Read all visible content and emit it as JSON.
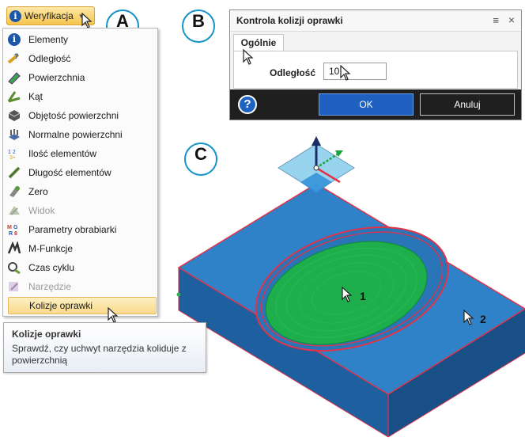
{
  "ribbon": {
    "label": "Weryfikacja",
    "icon": "info-icon"
  },
  "menu": {
    "items": [
      {
        "label": "Elementy",
        "icon": "info-icon",
        "enabled": true
      },
      {
        "label": "Odległość",
        "icon": "ruler-distance-icon",
        "enabled": true
      },
      {
        "label": "Powierzchnia",
        "icon": "surface-icon",
        "enabled": true
      },
      {
        "label": "Kąt",
        "icon": "angle-icon",
        "enabled": true
      },
      {
        "label": "Objętość powierzchni",
        "icon": "volume-icon",
        "enabled": true
      },
      {
        "label": "Normalne powierzchni",
        "icon": "normals-icon",
        "enabled": true
      },
      {
        "label": "Ilość elementów",
        "icon": "count-icon",
        "enabled": true
      },
      {
        "label": "Długość elementów",
        "icon": "length-icon",
        "enabled": true
      },
      {
        "label": "Zero",
        "icon": "zero-icon",
        "enabled": true
      },
      {
        "label": "Widok",
        "icon": "view-icon",
        "enabled": false
      },
      {
        "label": "Parametry obrabiarki",
        "icon": "machine-params-icon",
        "enabled": true
      },
      {
        "label": "M-Funkcje",
        "icon": "m-functions-icon",
        "enabled": true
      },
      {
        "label": "Czas cyklu",
        "icon": "cycle-time-icon",
        "enabled": true
      },
      {
        "label": "Narzędzie",
        "icon": "tool-icon",
        "enabled": false
      }
    ],
    "highlighted": {
      "label": "Kolizje oprawki"
    }
  },
  "tooltip": {
    "title": "Kolizje oprawki",
    "description": "Sprawdź, czy uchwyt narzędzia koliduje z powierzchnią"
  },
  "callouts": {
    "a": "A",
    "b": "B",
    "c": "C"
  },
  "dialog": {
    "title": "Kontrola kolizji oprawki",
    "tab": "Ogólnie",
    "distance_label": "Odległość",
    "distance_value": "10",
    "ok_label": "OK",
    "cancel_label": "Anuluj",
    "help_glyph": "?"
  },
  "scene": {
    "label_1": "1",
    "label_2": "2"
  },
  "colors": {
    "block_top": "#2f82c8",
    "block_side": "#1f5e9e",
    "pocket": "#1fae4c",
    "edge": "#e0344a",
    "accent": "#1593c9"
  }
}
